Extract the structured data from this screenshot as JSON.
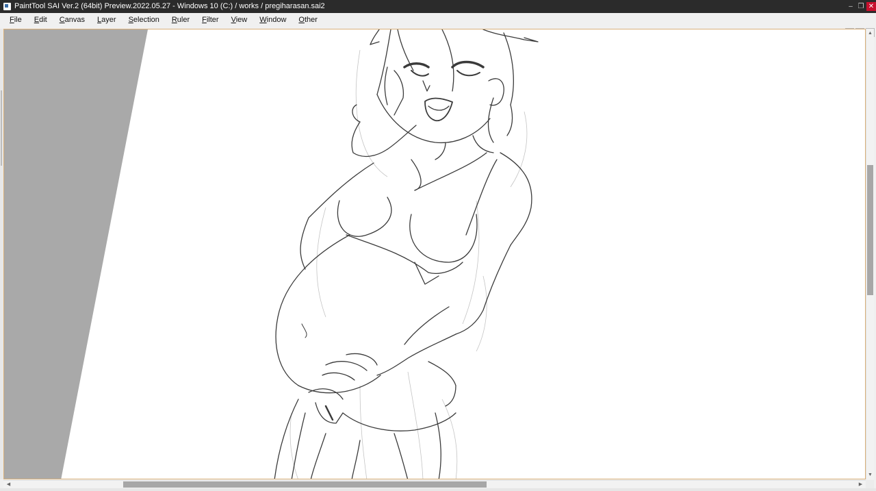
{
  "window": {
    "title": "PaintTool SAI Ver.2 (64bit) Preview.2022.05.27 - Windows 10 (C:) / works / pregiharasan.sai2",
    "controls": {
      "minimize": "–",
      "maximize": "❐",
      "close": "✕"
    }
  },
  "menu": {
    "items": [
      {
        "label": "File"
      },
      {
        "label": "Edit"
      },
      {
        "label": "Canvas"
      },
      {
        "label": "Layer"
      },
      {
        "label": "Selection"
      },
      {
        "label": "Ruler"
      },
      {
        "label": "Filter"
      },
      {
        "label": "View"
      },
      {
        "label": "Window"
      },
      {
        "label": "Other"
      }
    ],
    "doc_controls": {
      "minimize": "–",
      "restore": "❐",
      "close": "✕"
    }
  },
  "canvas": {
    "background_color": "#ffffff",
    "outside_color": "#a9a9a9",
    "line_color": "#3a3a3a",
    "sketch_color": "#c4c4c4"
  },
  "scrollbars": {
    "vertical": {
      "position": 0.42,
      "visible_fraction": 0.3
    },
    "horizontal": {
      "position": 0.23,
      "visible_fraction": 0.43
    },
    "arrows": {
      "up": "▲",
      "down": "▼",
      "left": "◀",
      "right": "▶"
    }
  }
}
